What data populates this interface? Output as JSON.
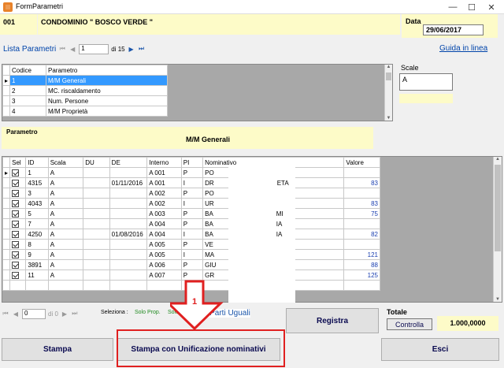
{
  "window": {
    "title": "FormParametri",
    "min": "—",
    "max": "☐",
    "close": "✕"
  },
  "header": {
    "code": "001",
    "name": "CONDOMINIO \" BOSCO VERDE \"",
    "date_label": "Data",
    "date_value": "29/06/2017"
  },
  "nav": {
    "label": "Lista Parametri",
    "first": "⏮",
    "prev": "◀",
    "current": "1",
    "of": "di 15",
    "next": "▶",
    "last": "⏭"
  },
  "help_link": "Guida in linea",
  "params_grid": {
    "columns": [
      "Codice",
      "Parametro"
    ],
    "rows": [
      {
        "code": "1",
        "name": "M/M Generali",
        "selected": true
      },
      {
        "code": "2",
        "name": "MC. riscaldamento",
        "selected": false
      },
      {
        "code": "3",
        "name": "Num. Persone",
        "selected": false
      },
      {
        "code": "4",
        "name": "M/M Proprietà",
        "selected": false
      }
    ]
  },
  "scale": {
    "label": "Scale",
    "value": "A"
  },
  "parametro": {
    "label": "Parametro",
    "value": "M/M Generali"
  },
  "units_grid": {
    "columns": [
      "Sel",
      "ID",
      "Scala",
      "DU",
      "DE",
      "Interno",
      "PI",
      "Nominativo",
      "Valore"
    ],
    "rows": [
      {
        "id": "1",
        "scala": "A",
        "du": "",
        "de": "",
        "interno": "A 001",
        "pi": "P",
        "nom": "PO",
        "valore": ""
      },
      {
        "id": "4315",
        "scala": "A",
        "du": "",
        "de": "01/11/2016",
        "interno": "A 001",
        "pi": "I",
        "nom": "DR",
        "valore": "83"
      },
      {
        "id": "3",
        "scala": "A",
        "du": "",
        "de": "",
        "interno": "A 002",
        "pi": "P",
        "nom": "PO",
        "valore": ""
      },
      {
        "id": "4043",
        "scala": "A",
        "du": "",
        "de": "",
        "interno": "A 002",
        "pi": "I",
        "nom": "UR",
        "valore": "83"
      },
      {
        "id": "5",
        "scala": "A",
        "du": "",
        "de": "",
        "interno": "A 003",
        "pi": "P",
        "nom": "BA",
        "valore": "75"
      },
      {
        "id": "7",
        "scala": "A",
        "du": "",
        "de": "",
        "interno": "A 004",
        "pi": "P",
        "nom": "BA",
        "valore": ""
      },
      {
        "id": "4250",
        "scala": "A",
        "du": "",
        "de": "01/08/2016",
        "interno": "A 004",
        "pi": "I",
        "nom": "BA",
        "valore": "82"
      },
      {
        "id": "8",
        "scala": "A",
        "du": "",
        "de": "",
        "interno": "A 005",
        "pi": "P",
        "nom": "VE",
        "valore": ""
      },
      {
        "id": "9",
        "scala": "A",
        "du": "",
        "de": "",
        "interno": "A 005",
        "pi": "I",
        "nom": "MA",
        "valore": "121"
      },
      {
        "id": "3891",
        "scala": "A",
        "du": "",
        "de": "",
        "interno": "A 006",
        "pi": "P",
        "nom": "GIU",
        "valore": "88"
      },
      {
        "id": "11",
        "scala": "A",
        "du": "",
        "de": "",
        "interno": "A 007",
        "pi": "P",
        "nom": "GR",
        "valore": "125"
      },
      {
        "id": "",
        "scala": "",
        "du": "",
        "de": "",
        "interno": "",
        "pi": "",
        "nom": "",
        "valore": ""
      }
    ],
    "nom_suffix": {
      "1": "ETA",
      "4": "MI",
      "5": "IA",
      "6": "IA"
    }
  },
  "bottom_nav": {
    "first": "⏮",
    "prev": "◀",
    "current": "0",
    "of": "di 0",
    "next": "▶",
    "last": "⏭",
    "selez_label": "Seleziona :",
    "solo_prop": "Solo Prop.",
    "solo_inq": "Solo Inq.",
    "ins_parti": "Ins Parti Uguali"
  },
  "buttons": {
    "registra": "Registra",
    "stampa": "Stampa",
    "stampa_unif": "Stampa con Unificazione nominativi",
    "esci": "Esci",
    "controlla": "Controlla"
  },
  "totale": {
    "label": "Totale",
    "value": "1.000,0000"
  },
  "annotation": {
    "number": "1",
    "color": "#e02020"
  }
}
